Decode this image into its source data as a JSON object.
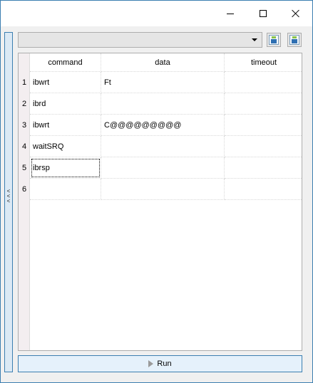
{
  "window": {
    "controls": {
      "minimize": "minimize-icon",
      "maximize": "maximize-icon",
      "close": "close-icon"
    }
  },
  "side_panel": {
    "expand_glyph": "<<<"
  },
  "toolbar": {
    "dropdown_value": "",
    "icons": [
      "load-icon",
      "save-icon"
    ]
  },
  "grid": {
    "columns": [
      "command",
      "data",
      "timeout"
    ],
    "rows": [
      {
        "num": "1",
        "command": "ibwrt",
        "data": "Ft",
        "timeout": ""
      },
      {
        "num": "2",
        "command": "ibrd",
        "data": "",
        "timeout": ""
      },
      {
        "num": "3",
        "command": "ibwrt",
        "data": "C@@@@@@@@@",
        "timeout": ""
      },
      {
        "num": "4",
        "command": "waitSRQ",
        "data": "",
        "timeout": ""
      },
      {
        "num": "5",
        "command": "ibrsp",
        "data": "",
        "timeout": ""
      },
      {
        "num": "6",
        "command": "",
        "data": "",
        "timeout": ""
      }
    ],
    "selected_row": 5,
    "selected_column": "command"
  },
  "run_button": {
    "label": "Run",
    "icon": "play-icon"
  }
}
